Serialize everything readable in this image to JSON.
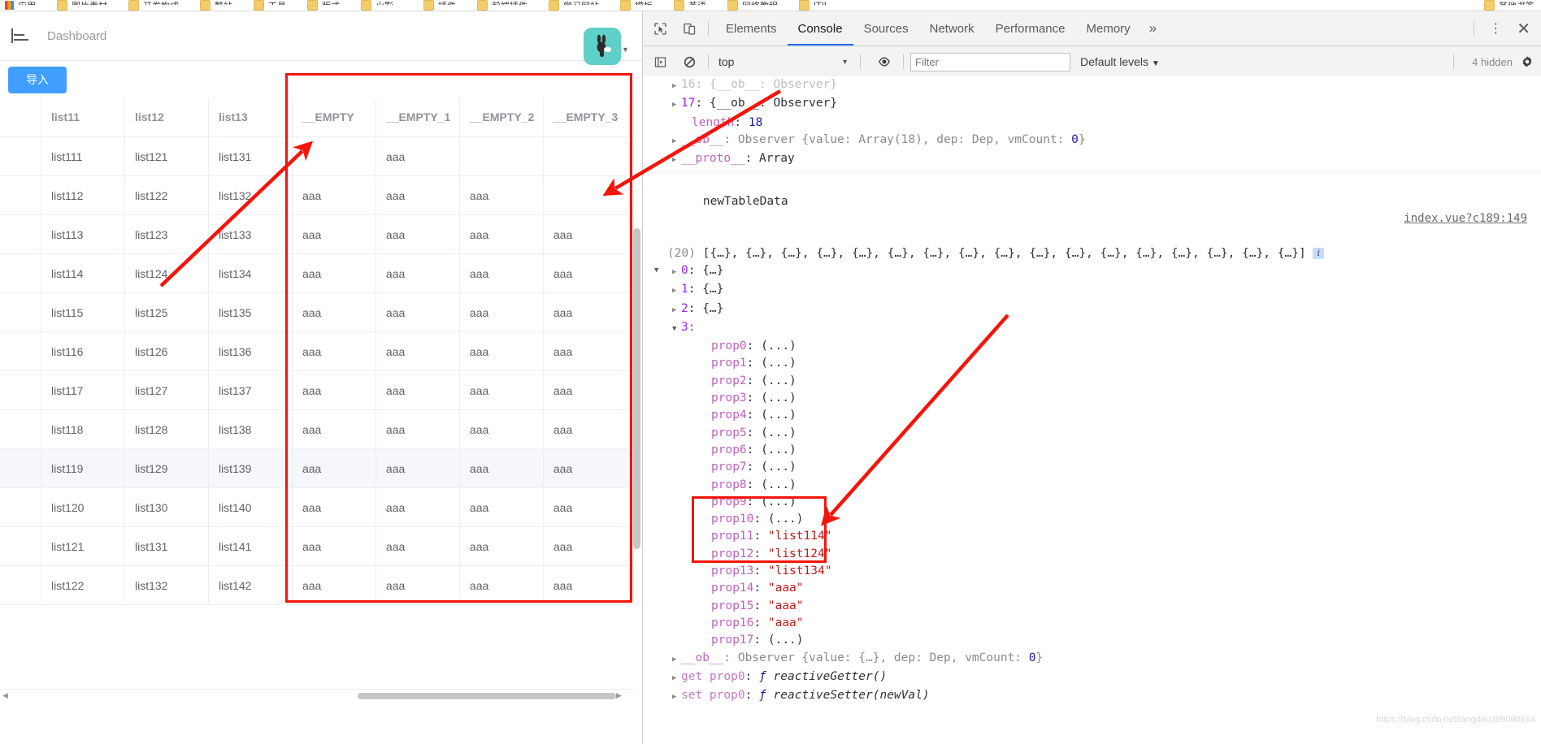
{
  "browser": {
    "bookmarks": [
      {
        "label": "应用",
        "icon": "apps-grid-icon"
      },
      {
        "label": "图片素材",
        "icon": "folder-icon"
      },
      {
        "label": "开发构成",
        "icon": "folder-icon"
      },
      {
        "label": "酷站",
        "icon": "folder-icon"
      },
      {
        "label": "工具",
        "icon": "folder-icon"
      },
      {
        "label": "版式",
        "icon": "folder-icon"
      },
      {
        "label": "火影、",
        "icon": "folder-icon"
      },
      {
        "label": "插件",
        "icon": "folder-icon"
      },
      {
        "label": "前端插件",
        "icon": "folder-icon"
      },
      {
        "label": "学习网站",
        "icon": "folder-icon"
      },
      {
        "label": "模板",
        "icon": "folder-icon"
      },
      {
        "label": "英语",
        "icon": "folder-icon"
      },
      {
        "label": "网络教程",
        "icon": "folder-icon"
      },
      {
        "label": "ITIL",
        "icon": "folder-icon"
      },
      {
        "label": "其他书签",
        "icon": "folder-icon"
      }
    ]
  },
  "app": {
    "menu_icon": "menu-fold-icon",
    "breadcrumb": "Dashboard",
    "import_button": "导入",
    "extension_icon": "rabbit-avatar-icon",
    "table": {
      "columns": [
        "",
        "list11",
        "list12",
        "list13",
        "__EMPTY",
        "__EMPTY_1",
        "__EMPTY_2",
        "__EMPTY_3"
      ],
      "rows": [
        [
          "",
          "list111",
          "list121",
          "list131",
          "",
          "aaa",
          "",
          ""
        ],
        [
          "",
          "list112",
          "list122",
          "list132",
          "aaa",
          "aaa",
          "aaa",
          ""
        ],
        [
          "",
          "list113",
          "list123",
          "list133",
          "aaa",
          "aaa",
          "aaa",
          "aaa"
        ],
        [
          "",
          "list114",
          "list124",
          "list134",
          "aaa",
          "aaa",
          "aaa",
          "aaa"
        ],
        [
          "",
          "list115",
          "list125",
          "list135",
          "aaa",
          "aaa",
          "aaa",
          "aaa"
        ],
        [
          "",
          "list116",
          "list126",
          "list136",
          "aaa",
          "aaa",
          "aaa",
          "aaa"
        ],
        [
          "",
          "list117",
          "list127",
          "list137",
          "aaa",
          "aaa",
          "aaa",
          "aaa"
        ],
        [
          "",
          "list118",
          "list128",
          "list138",
          "aaa",
          "aaa",
          "aaa",
          "aaa"
        ],
        [
          "",
          "list119",
          "list129",
          "list139",
          "aaa",
          "aaa",
          "aaa",
          "aaa"
        ],
        [
          "",
          "list120",
          "list130",
          "list140",
          "aaa",
          "aaa",
          "aaa",
          "aaa"
        ],
        [
          "",
          "list121",
          "list131",
          "list141",
          "aaa",
          "aaa",
          "aaa",
          "aaa"
        ],
        [
          "",
          "list122",
          "list132",
          "list142",
          "aaa",
          "aaa",
          "aaa",
          "aaa"
        ]
      ]
    }
  },
  "devtools": {
    "inspect_icon": "inspect-element-icon",
    "device_icon": "toggle-device-toolbar-icon",
    "tabs": [
      {
        "label": "Elements",
        "active": false
      },
      {
        "label": "Console",
        "active": true
      },
      {
        "label": "Sources",
        "active": false
      },
      {
        "label": "Network",
        "active": false
      },
      {
        "label": "Performance",
        "active": false
      },
      {
        "label": "Memory",
        "active": false
      }
    ],
    "more_tabs_icon": "chevron-double-right-icon",
    "kebab_icon": "more-vertical-icon",
    "close_icon": "close-icon",
    "filterbar": {
      "sidebar_icon": "show-console-sidebar-icon",
      "clear_icon": "clear-console-icon",
      "context": "top",
      "context_caret": "chevron-down-icon",
      "eye_icon": "live-expression-icon",
      "filter_placeholder": "Filter",
      "filter_value": "",
      "levels": "Default levels",
      "levels_caret": "chevron-down-icon",
      "hidden_count": "4 hidden",
      "settings_icon": "gear-icon"
    },
    "console": {
      "lines": [
        {
          "id": "l16",
          "text": "16: {__ob__: Observer}"
        },
        {
          "id": "l17",
          "text": "17: {__ob__: Observer}"
        },
        {
          "id": "len",
          "key": "length",
          "value": "18"
        },
        {
          "id": "ob1",
          "text": "__ob__: Observer {value: Array(18), dep: Dep, vmCount: 0}"
        },
        {
          "id": "proto1",
          "text": "__proto__: Array"
        }
      ],
      "message_label": "newTableData",
      "source_link": "index.vue?c189:149",
      "array_preview_count": "(20)",
      "array_preview": "[{…}, {…}, {…}, {…}, {…}, {…}, {…}, {…}, {…}, {…}, {…}, {…}, {…}, {…}, {…}, {…}, {…}]",
      "info_badge": "i",
      "entries": [
        "0: {…}",
        "1: {…}",
        "2: {…}"
      ],
      "expanded_index": "3:",
      "props": [
        {
          "name": "prop0",
          "value": "(...)",
          "type": "getter"
        },
        {
          "name": "prop1",
          "value": "(...)",
          "type": "getter"
        },
        {
          "name": "prop2",
          "value": "(...)",
          "type": "getter"
        },
        {
          "name": "prop3",
          "value": "(...)",
          "type": "getter"
        },
        {
          "name": "prop4",
          "value": "(...)",
          "type": "getter"
        },
        {
          "name": "prop5",
          "value": "(...)",
          "type": "getter"
        },
        {
          "name": "prop6",
          "value": "(...)",
          "type": "getter"
        },
        {
          "name": "prop7",
          "value": "(...)",
          "type": "getter"
        },
        {
          "name": "prop8",
          "value": "(...)",
          "type": "getter"
        },
        {
          "name": "prop9",
          "value": "(...)",
          "type": "getter"
        },
        {
          "name": "prop10",
          "value": "(...)",
          "type": "getter"
        },
        {
          "name": "prop11",
          "value": "\"list114\"",
          "type": "string"
        },
        {
          "name": "prop12",
          "value": "\"list124\"",
          "type": "string"
        },
        {
          "name": "prop13",
          "value": "\"list134\"",
          "type": "string"
        },
        {
          "name": "prop14",
          "value": "\"aaa\"",
          "type": "string"
        },
        {
          "name": "prop15",
          "value": "\"aaa\"",
          "type": "string"
        },
        {
          "name": "prop16",
          "value": "\"aaa\"",
          "type": "string"
        },
        {
          "name": "prop17",
          "value": "(...)",
          "type": "getter"
        }
      ],
      "footer_lines": [
        {
          "prefix": "__ob__",
          "rest": ": Observer {value: {…}, dep: Dep, vmCount: 0}"
        },
        {
          "prefix": "get prop0",
          "rest": ": ƒ reactiveGetter()"
        },
        {
          "prefix": "set prop0",
          "rest": ": ƒ reactiveSetter(newVal)"
        }
      ]
    }
  },
  "watermark": "https://blog.csdn.net/langdou369098654",
  "annotations": {
    "arrows": [
      "arrow-to-empty-column",
      "arrow-to-empty3-column",
      "arrow-to-prop14"
    ],
    "boxes": [
      "red-box-empty-columns",
      "red-box-prop14-prop17"
    ],
    "color": "#f5140a"
  }
}
